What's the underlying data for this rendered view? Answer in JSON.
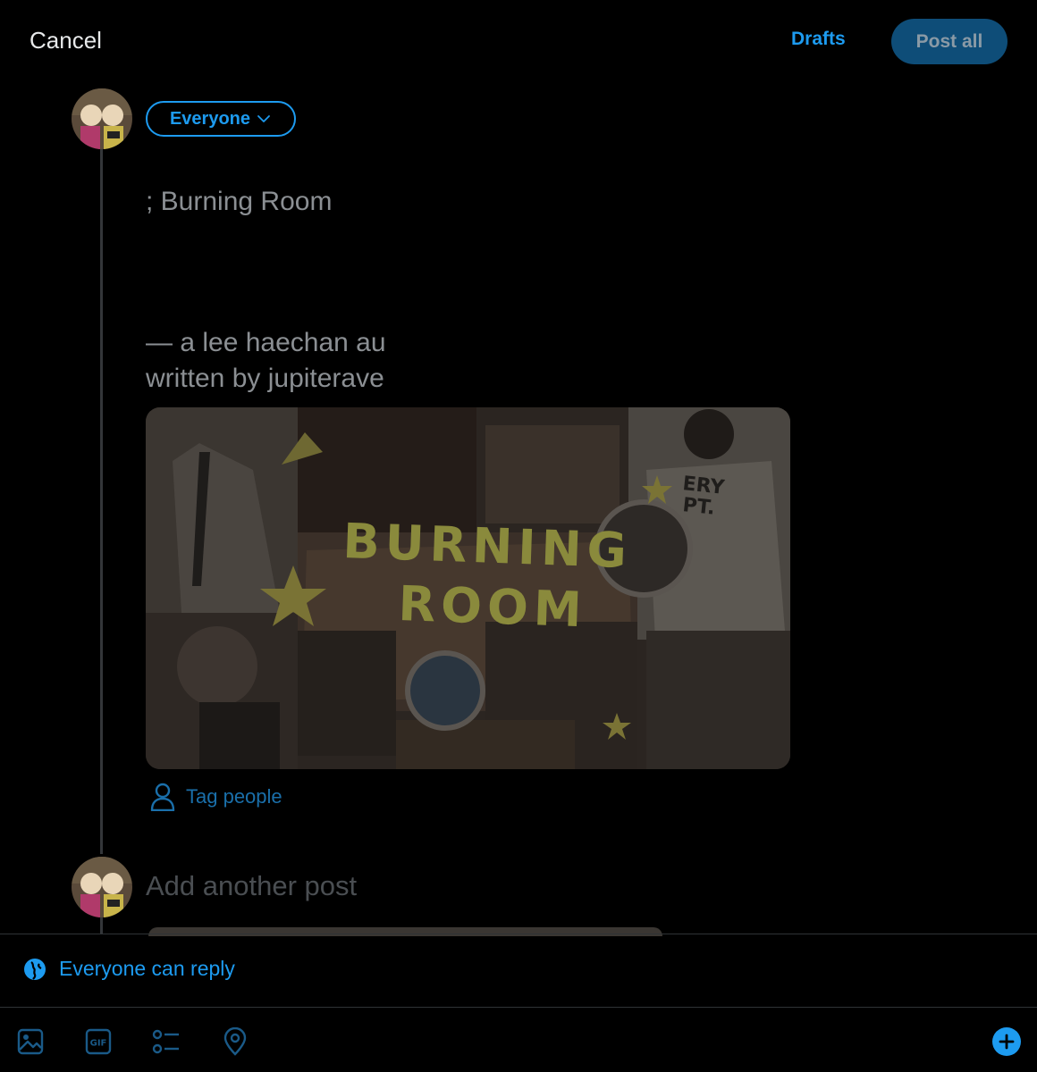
{
  "header": {
    "cancel_label": "Cancel",
    "drafts_label": "Drafts",
    "post_all_label": "Post all"
  },
  "composer": {
    "audience_label": "Everyone",
    "post_title": "; Burning Room",
    "post_body": "— a lee haechan au\nwritten by jupiterave",
    "media_caption": "BURNING\nROOM",
    "tag_people_label": "Tag people",
    "add_post_placeholder": "Add another post"
  },
  "reply_setting": {
    "label": "Everyone can reply"
  },
  "toolbar": {
    "icons": [
      "image-icon",
      "gif-icon",
      "poll-icon",
      "location-icon",
      "add-thread-icon"
    ]
  },
  "colors": {
    "accent": "#1d9bf0",
    "background": "#000000",
    "muted_text": "#8b8f93",
    "placeholder": "#4a4e52"
  }
}
